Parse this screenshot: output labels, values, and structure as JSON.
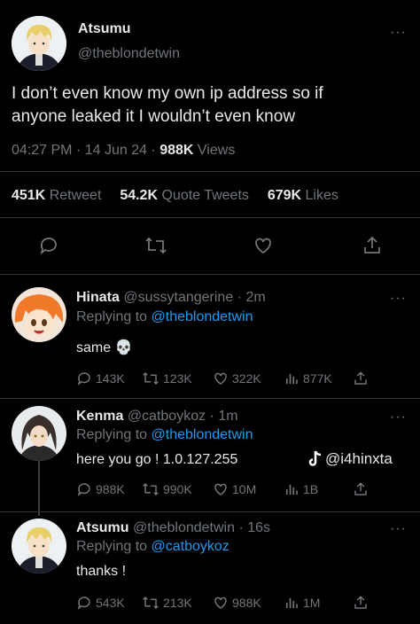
{
  "main_tweet": {
    "name": "Atsumu",
    "handle": "@theblondetwin",
    "text_line1": "I don’t even know my own ip address so if",
    "text_line2": "anyone leaked it I wouldn’t even know",
    "time": "04:27 PM · 14 Jun 24 ·",
    "views_count": "988K",
    "views_label": "Views",
    "retweets_count": "451K",
    "retweets_label": "Retweet",
    "quotes_count": "54.2K",
    "quotes_label": "Quote Tweets",
    "likes_count": "679K",
    "likes_label": "Likes"
  },
  "replies": [
    {
      "name": "Hinata",
      "handle_time": "@sussytangerine · 2m",
      "replying_prefix": "Replying to",
      "replying_to": "@theblondetwin",
      "text": "same 💀",
      "replies": "143K",
      "retweets": "123K",
      "likes": "322K",
      "views": "877K"
    },
    {
      "name": "Kenma",
      "handle_time": "@catboykoz · 1m",
      "replying_prefix": "Replying to",
      "replying_to": "@theblondetwin",
      "text": "here you go ! 1.0.127.255",
      "replies": "988K",
      "retweets": "990K",
      "likes": "10M",
      "views": "1B"
    },
    {
      "name": "Atsumu",
      "handle_time": "@theblondetwin · 16s",
      "replying_prefix": "Replying to",
      "replying_to": "@catboykoz",
      "text": "thanks !",
      "replies": "543K",
      "retweets": "213K",
      "likes": "988K",
      "views": "1M"
    }
  ],
  "watermark": "@i4hinxta",
  "more_glyph": "···",
  "colors": {
    "background": "#000000",
    "text": "#e7e9ea",
    "dim": "#71767b",
    "link": "#1d9bf0",
    "divider": "#2f3336"
  }
}
